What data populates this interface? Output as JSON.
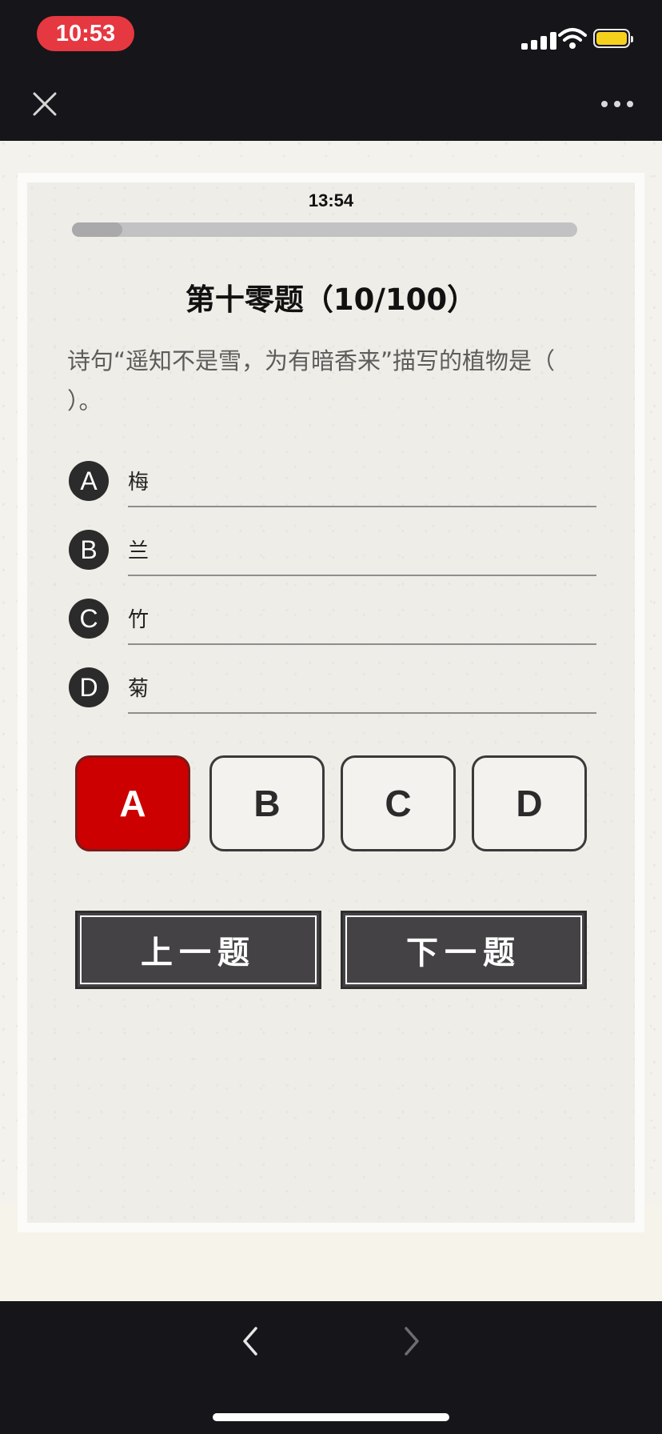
{
  "status_bar": {
    "time": "10:53"
  },
  "quiz": {
    "timer": "13:54",
    "progress": 0.1,
    "title": "第十零题（10/100）",
    "question": "诗句“遥知不是雪，为有暗香来”描写的植物是（ ）。",
    "options": [
      {
        "letter": "A",
        "text": "梅"
      },
      {
        "letter": "B",
        "text": "兰"
      },
      {
        "letter": "C",
        "text": "竹"
      },
      {
        "letter": "D",
        "text": "菊"
      }
    ],
    "answer_buttons": [
      "A",
      "B",
      "C",
      "D"
    ],
    "selected": "A",
    "prev_label": "上一题",
    "next_label": "下一题"
  },
  "colors": {
    "selected": "#cc0000",
    "status_pill": "#e53841",
    "battery": "#f5d11d"
  },
  "icons": [
    "close-icon",
    "more-icon",
    "signal-icon",
    "wifi-icon",
    "battery-icon",
    "back-arrow-icon",
    "forward-arrow-icon"
  ]
}
